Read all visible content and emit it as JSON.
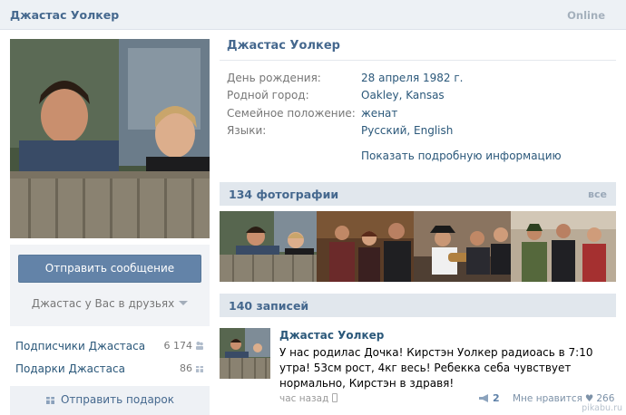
{
  "header": {
    "name": "Джастас Уолкер",
    "status": "Online"
  },
  "left": {
    "send_message": "Отправить сообщение",
    "friend_status": "Джастас у Вас в друзьях",
    "links": [
      {
        "label": "Подписчики Джастаса",
        "count": "6 174"
      },
      {
        "label": "Подарки Джастаса",
        "count": "86"
      }
    ],
    "send_gift": "Отправить подарок"
  },
  "profile": {
    "name": "Джастас Уолкер",
    "info": [
      {
        "label": "День рождения:",
        "value": "28 апреля 1982 г."
      },
      {
        "label": "Родной город:",
        "value": "Oakley, Kansas"
      },
      {
        "label": "Семейное положение:",
        "value": "женат"
      },
      {
        "label": "Языки:",
        "value": "Русский, English"
      }
    ],
    "more_info": "Показать подробную информацию"
  },
  "photos": {
    "title": "134 фотографии",
    "all": "все"
  },
  "posts": {
    "title": "140 записей",
    "items": [
      {
        "author": "Джастас Уолкер",
        "text": "У нас родилас Дочка! Кирстэн Уолкер радиоась в 7:10 утра! 53см рост, 4кг весь! Ребекка себа чувствует нормально, Кирстэн в здравя!",
        "time": "час назад",
        "reposts": "2",
        "like_label": "Мне нравится",
        "likes": "266"
      }
    ]
  },
  "watermark": "pikabu.ru",
  "colors": {
    "accent": "#45688e",
    "link": "#2b587a",
    "button": "#6383a8",
    "bar": "#e1e7ed"
  }
}
